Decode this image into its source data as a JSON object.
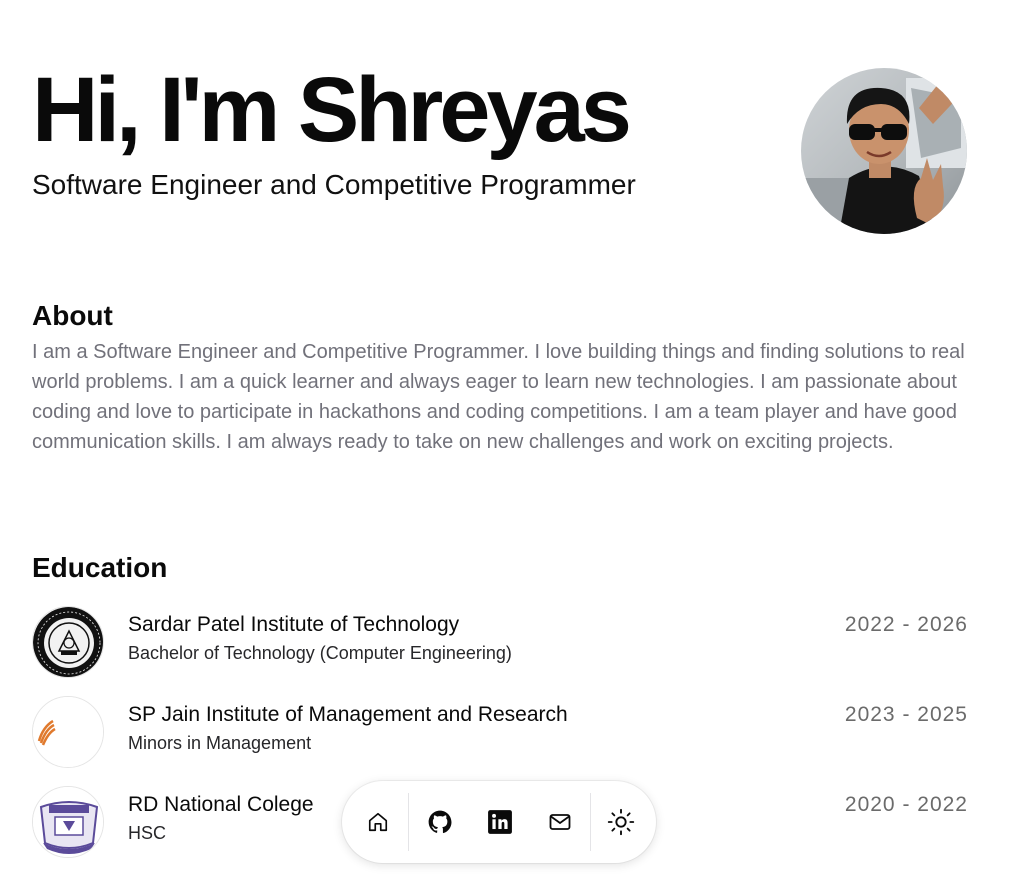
{
  "hero": {
    "title": "Hi, I'm Shreyas",
    "subtitle": "Software Engineer and Competitive Programmer"
  },
  "about": {
    "heading": "About",
    "text": "I am a Software Engineer and Competitive Programmer. I love building things and finding solutions to real world problems. I am a quick learner and always eager to learn new technologies. I am passionate about coding and love to participate in hackathons and coding competitions. I am a team player and have good communication skills. I am always ready to take on new challenges and work on exciting projects."
  },
  "education": {
    "heading": "Education",
    "items": [
      {
        "school": "Sardar Patel Institute of Technology",
        "degree": "Bachelor of Technology (Computer Engineering)",
        "years": "2022 - 2026",
        "logo": "spit-logo-icon"
      },
      {
        "school": "SP Jain Institute of Management and Research",
        "degree": "Minors in Management",
        "years": "2023 - 2025",
        "logo": "spjimr-logo-icon"
      },
      {
        "school": "RD National Colege",
        "degree": "HSC",
        "years": "2020 - 2022",
        "logo": "rd-national-logo-icon"
      }
    ]
  },
  "dock": {
    "items": [
      "home-icon",
      "github-icon",
      "linkedin-icon",
      "mail-icon",
      "sun-icon"
    ]
  },
  "colors": {
    "text": "#0a0a0a",
    "muted": "#71717a",
    "spjimr_accent": "#e07a2e",
    "rd_badge": "#5b4b9a"
  }
}
